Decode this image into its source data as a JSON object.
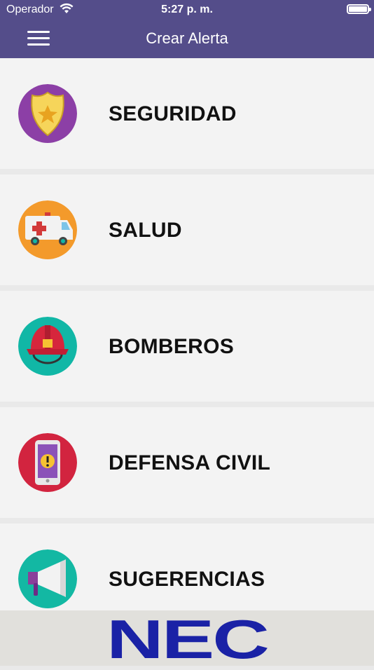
{
  "status": {
    "carrier": "Operador",
    "time": "5:27 p. m."
  },
  "header": {
    "title": "Crear Alerta"
  },
  "items": [
    {
      "label": "SEGURIDAD",
      "icon": "police-badge-icon",
      "color": "#8c3fa6"
    },
    {
      "label": "SALUD",
      "icon": "ambulance-icon",
      "color": "#f39a2b"
    },
    {
      "label": "BOMBEROS",
      "icon": "firefighter-helmet-icon",
      "color": "#11b7a6"
    },
    {
      "label": "DEFENSA CIVIL",
      "icon": "phone-alert-icon",
      "color": "#d2243f"
    },
    {
      "label": "SUGERENCIAS",
      "icon": "megaphone-icon",
      "color": "#13b8a3"
    }
  ],
  "footer": {
    "logo_text": "NEC",
    "logo_color": "#1a22a6"
  }
}
